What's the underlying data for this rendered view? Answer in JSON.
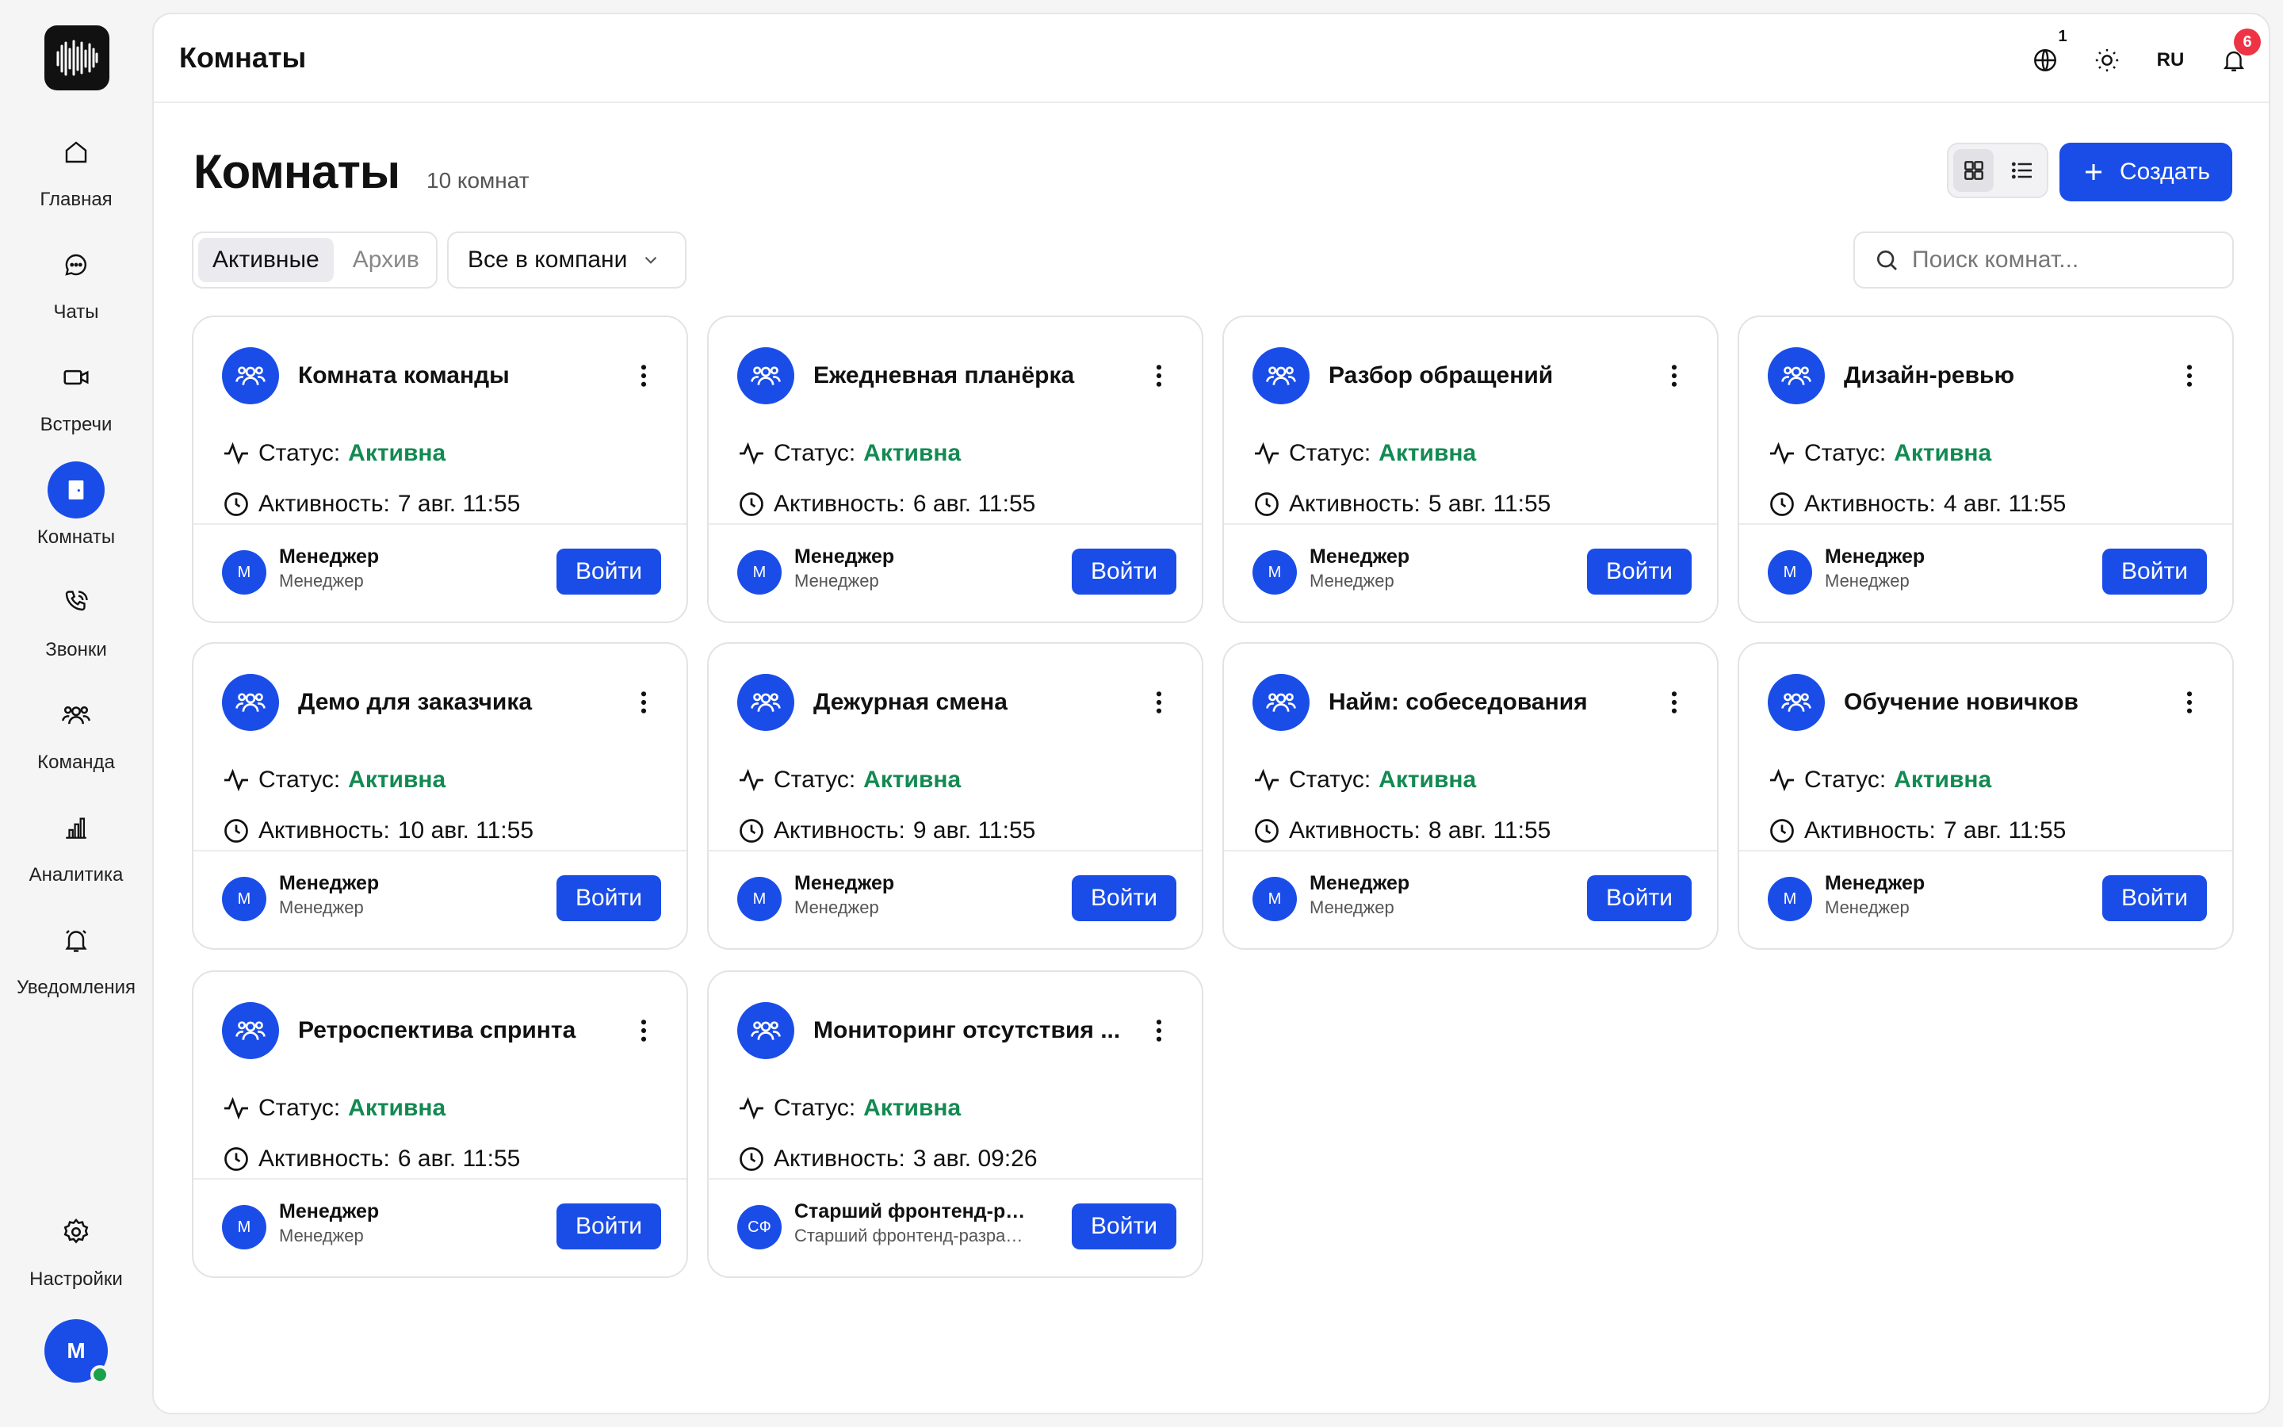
{
  "sidebar": {
    "items": [
      {
        "key": "home",
        "label": "Главная",
        "icon": "home-icon"
      },
      {
        "key": "chats",
        "label": "Чаты",
        "icon": "chat-icon"
      },
      {
        "key": "meetings",
        "label": "Встречи",
        "icon": "video-icon"
      },
      {
        "key": "rooms",
        "label": "Комнаты",
        "icon": "door-icon",
        "active": true
      },
      {
        "key": "calls",
        "label": "Звонки",
        "icon": "phone-icon"
      },
      {
        "key": "team",
        "label": "Команда",
        "icon": "team-icon"
      },
      {
        "key": "analytics",
        "label": "Аналитика",
        "icon": "chart-icon"
      },
      {
        "key": "notifications",
        "label": "Уведомления",
        "icon": "bell-icon"
      }
    ],
    "settings_label": "Настройки",
    "user_initial": "М"
  },
  "topbar": {
    "title": "Комнаты",
    "globe_badge": "1",
    "lang": "RU",
    "bell_badge": "6"
  },
  "page": {
    "title": "Комнаты",
    "count": "10 комнат",
    "create_label": "Создать",
    "filters": {
      "active": "Активные",
      "archive": "Архив"
    },
    "scope_select": "Все в компании",
    "search_placeholder": "Поиск комнат..."
  },
  "colors": {
    "accent": "#1a4de8",
    "status": "#138a52"
  },
  "card_labels": {
    "status": "Статус:",
    "activity": "Активность:",
    "enter": "Войти"
  },
  "rooms": [
    {
      "name": "Комната команды",
      "status": "Активна",
      "activity": "7 авг. 11:55",
      "owner_initials": "М",
      "owner_name": "Менеджер",
      "owner_role": "Менеджер"
    },
    {
      "name": "Ежедневная планёрка",
      "status": "Активна",
      "activity": "6 авг. 11:55",
      "owner_initials": "М",
      "owner_name": "Менеджер",
      "owner_role": "Менеджер"
    },
    {
      "name": "Разбор обращений",
      "status": "Активна",
      "activity": "5 авг. 11:55",
      "owner_initials": "М",
      "owner_name": "Менеджер",
      "owner_role": "Менеджер"
    },
    {
      "name": "Дизайн-ревью",
      "status": "Активна",
      "activity": "4 авг. 11:55",
      "owner_initials": "М",
      "owner_name": "Менеджер",
      "owner_role": "Менеджер"
    },
    {
      "name": "Демо для заказчика",
      "status": "Активна",
      "activity": "10 авг. 11:55",
      "owner_initials": "М",
      "owner_name": "Менеджер",
      "owner_role": "Менеджер"
    },
    {
      "name": "Дежурная смена",
      "status": "Активна",
      "activity": "9 авг. 11:55",
      "owner_initials": "М",
      "owner_name": "Менеджер",
      "owner_role": "Менеджер"
    },
    {
      "name": "Найм: собеседования",
      "status": "Активна",
      "activity": "8 авг. 11:55",
      "owner_initials": "М",
      "owner_name": "Менеджер",
      "owner_role": "Менеджер"
    },
    {
      "name": "Обучение новичков",
      "status": "Активна",
      "activity": "7 авг. 11:55",
      "owner_initials": "М",
      "owner_name": "Менеджер",
      "owner_role": "Менеджер"
    },
    {
      "name": "Ретроспектива спринта",
      "status": "Активна",
      "activity": "6 авг. 11:55",
      "owner_initials": "М",
      "owner_name": "Менеджер",
      "owner_role": "Менеджер"
    },
    {
      "name": "Мониторинг отсутствия ...",
      "status": "Активна",
      "activity": "3 авг. 09:26",
      "owner_initials": "СФ",
      "owner_name": "Старший фронтенд-разра...",
      "owner_role": "Старший фронтенд-разрабо..."
    }
  ]
}
